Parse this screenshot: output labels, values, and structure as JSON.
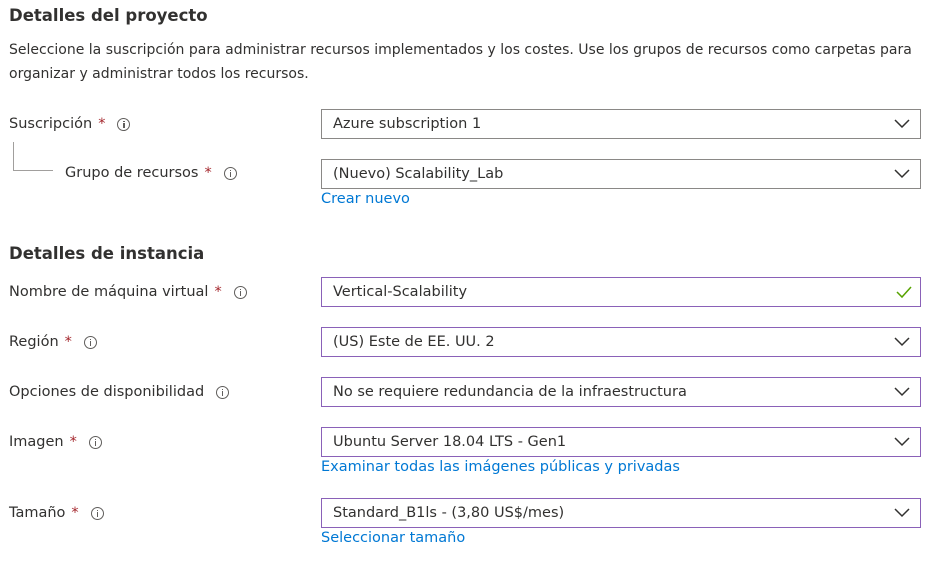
{
  "project": {
    "title": "Detalles del proyecto",
    "description": "Seleccione la suscripción para administrar recursos implementados y los costes. Use los grupos de recursos como carpetas para organizar y administrar todos los recursos.",
    "subscription": {
      "label": "Suscripción",
      "value": "Azure subscription 1"
    },
    "resource_group": {
      "label": "Grupo de recursos",
      "value": "(Nuevo) Scalability_Lab",
      "link": "Crear nuevo"
    }
  },
  "instance": {
    "title": "Detalles de instancia",
    "vm_name": {
      "label": "Nombre de máquina virtual",
      "value": "Vertical-Scalability"
    },
    "region": {
      "label": "Región",
      "value": "(US) Este de EE. UU. 2"
    },
    "availability": {
      "label": "Opciones de disponibilidad",
      "value": "No se requiere redundancia de la infraestructura"
    },
    "image": {
      "label": "Imagen",
      "value": "Ubuntu Server 18.04 LTS - Gen1",
      "link": "Examinar todas las imágenes públicas y privadas"
    },
    "size": {
      "label": "Tamaño",
      "value": "Standard_B1ls - (3,80 US$/mes)",
      "link": "Seleccionar tamaño"
    }
  },
  "common": {
    "required_marker": "*"
  },
  "colors": {
    "link": "#0078d4",
    "required": "#a4262c",
    "valid_check": "#57a300",
    "focus_border": "#8a61b8"
  }
}
